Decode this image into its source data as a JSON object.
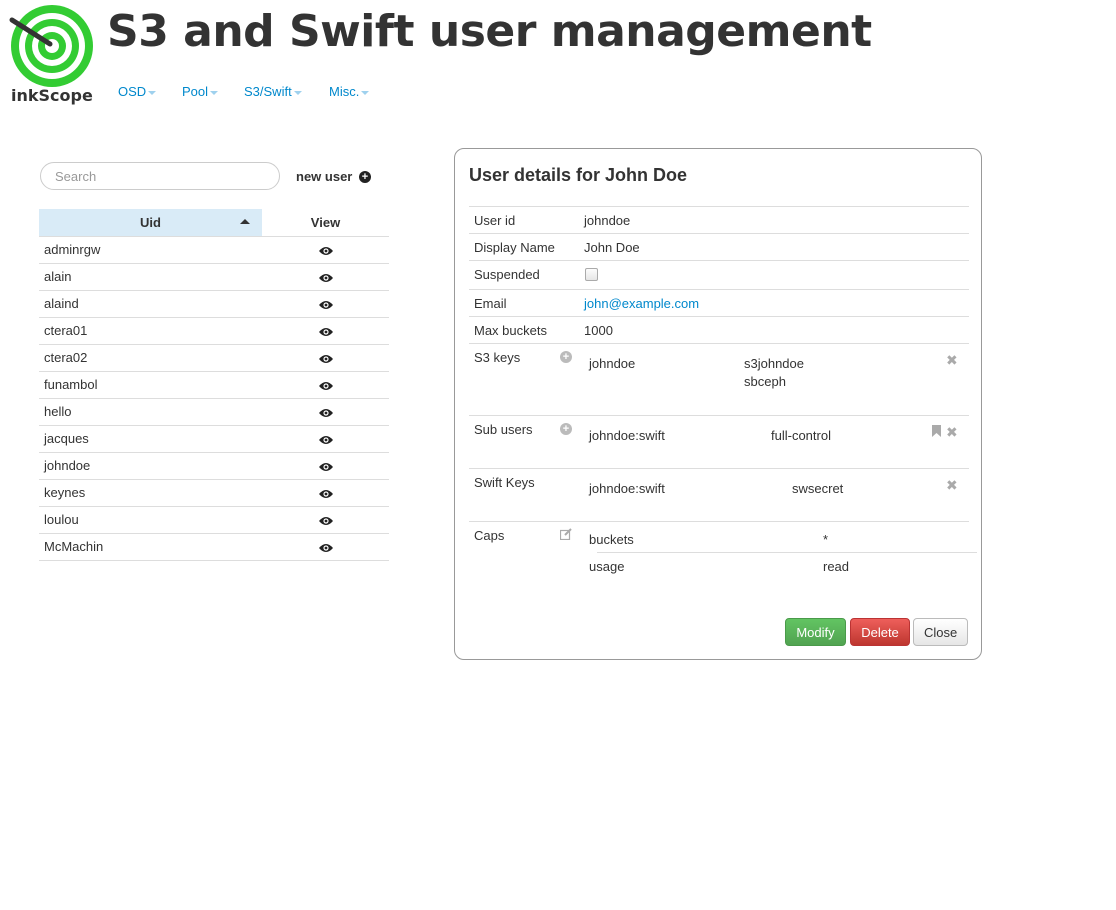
{
  "header": {
    "logo_text": "inkScope",
    "title": "S3 and Swift user management",
    "nav": [
      {
        "label": "OSD"
      },
      {
        "label": "Pool"
      },
      {
        "label": "S3/Swift"
      },
      {
        "label": "Misc."
      }
    ]
  },
  "user_list": {
    "search_placeholder": "Search",
    "new_user_label": "new user",
    "columns": {
      "uid": "Uid",
      "view": "View"
    },
    "sort": {
      "column": "uid",
      "direction": "ascending"
    },
    "users": [
      {
        "uid": "adminrgw"
      },
      {
        "uid": "alain"
      },
      {
        "uid": "alaind"
      },
      {
        "uid": "ctera01"
      },
      {
        "uid": "ctera02"
      },
      {
        "uid": "funambol"
      },
      {
        "uid": "hello"
      },
      {
        "uid": "jacques"
      },
      {
        "uid": "johndoe"
      },
      {
        "uid": "keynes"
      },
      {
        "uid": "loulou"
      },
      {
        "uid": "McMachin"
      }
    ]
  },
  "details": {
    "title": "User details for John Doe",
    "user_id_label": "User id",
    "user_id": "johndoe",
    "display_name_label": "Display Name",
    "display_name": "John Doe",
    "suspended_label": "Suspended",
    "suspended": false,
    "email_label": "Email",
    "email": "john@example.com",
    "max_buckets_label": "Max buckets",
    "max_buckets": "1000",
    "s3_keys_label": "S3 keys",
    "s3_keys": [
      {
        "user": "johndoe",
        "access_key": "s3johndoe",
        "secret_key": "sbceph"
      }
    ],
    "sub_users_label": "Sub users",
    "sub_users": [
      {
        "id": "johndoe:swift",
        "permissions": "full-control"
      }
    ],
    "swift_keys_label": "Swift Keys",
    "swift_keys": [
      {
        "user": "johndoe:swift",
        "secret_key": "swsecret"
      }
    ],
    "caps_label": "Caps",
    "caps": [
      {
        "type": "buckets",
        "perm": "*"
      },
      {
        "type": "usage",
        "perm": "read"
      }
    ],
    "buttons": {
      "modify": "Modify",
      "delete": "Delete",
      "close": "Close"
    }
  },
  "colors": {
    "link": "#0088cc",
    "logo_green": "#33cc33",
    "modify_button": "#51a351",
    "delete_button": "#bd362f",
    "sorted_header": "#d9ebf7"
  }
}
